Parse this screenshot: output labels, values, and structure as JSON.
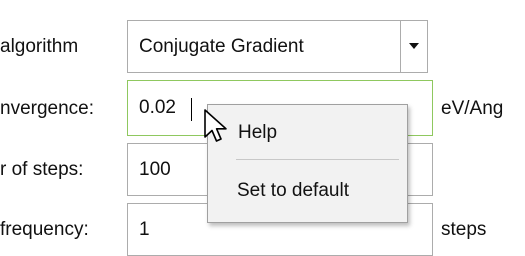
{
  "fields": {
    "algorithm": {
      "label": "algorithm",
      "value": "Conjugate Gradient"
    },
    "convergence": {
      "label": "nvergence:",
      "value": "0.02",
      "unit": "eV/Ang"
    },
    "steps": {
      "label": "r of steps:",
      "value": "100"
    },
    "frequency": {
      "label": "frequency:",
      "value": "1",
      "unit": "steps"
    }
  },
  "context_menu": {
    "items": [
      {
        "label": "Help"
      },
      {
        "label": "Set to default"
      }
    ]
  },
  "colors": {
    "focus_border": "#8fc85f",
    "menu_background": "#f2f2f2"
  },
  "icons": {
    "dropdown": "chevron-down-icon",
    "cursor": "mouse-pointer-icon"
  }
}
